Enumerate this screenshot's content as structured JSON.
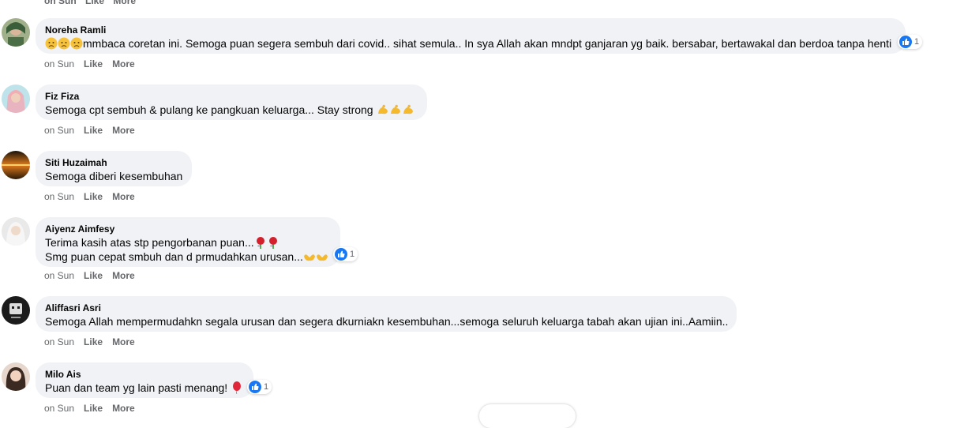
{
  "partial_top": {
    "time": "on Sun",
    "like": "Like",
    "more": "More"
  },
  "comments": [
    {
      "author": "Noreha Ramli",
      "text": "mmbaca coretan ini. Semoga puan segera sembuh dari covid.. sihat semula.. In sya Allah akan mndpt ganjaran yg baik. bersabar, bertawakal dan berdoa tanpa henti",
      "time": "on Sun",
      "like": "Like",
      "more": "More",
      "reaction_count": "1"
    },
    {
      "author": "Fiz Fiza",
      "text": "Semoga cpt sembuh & pulang ke pangkuan keluarga... Stay strong",
      "time": "on Sun",
      "like": "Like",
      "more": "More"
    },
    {
      "author": "Siti Huzaimah",
      "text": "Semoga diberi kesembuhan",
      "time": "on Sun",
      "like": "Like",
      "more": "More"
    },
    {
      "author": "Aiyenz Aimfesy",
      "line1": "Terima kasih atas stp pengorbanan puan...",
      "line2": "Smg puan cepat smbuh dan d prmudahkan urusan...",
      "time": "on Sun",
      "like": "Like",
      "more": "More",
      "reaction_count": "1"
    },
    {
      "author": "Aliffasri Asri",
      "text": "Semoga Allah mempermudahkn segala urusan dan segera dkurniakn kesembuhan...semoga seluruh keluarga tabah akan ujian ini..Aamiin..",
      "time": "on Sun",
      "like": "Like",
      "more": "More"
    },
    {
      "author": "Milo Ais",
      "text": "Puan dan team yg lain pasti menang!",
      "time": "on Sun",
      "like": "Like",
      "more": "More",
      "reaction_count": "1"
    }
  ],
  "colors": {
    "bubble": "#f0f2f5",
    "like_blue": "#1877f2",
    "meta_gray": "#65676b"
  },
  "icons": [
    "sad-face-emoji",
    "flexed-biceps-emoji",
    "rose-emoji",
    "open-hands-emoji",
    "balloon-emoji",
    "like-reaction-icon"
  ]
}
